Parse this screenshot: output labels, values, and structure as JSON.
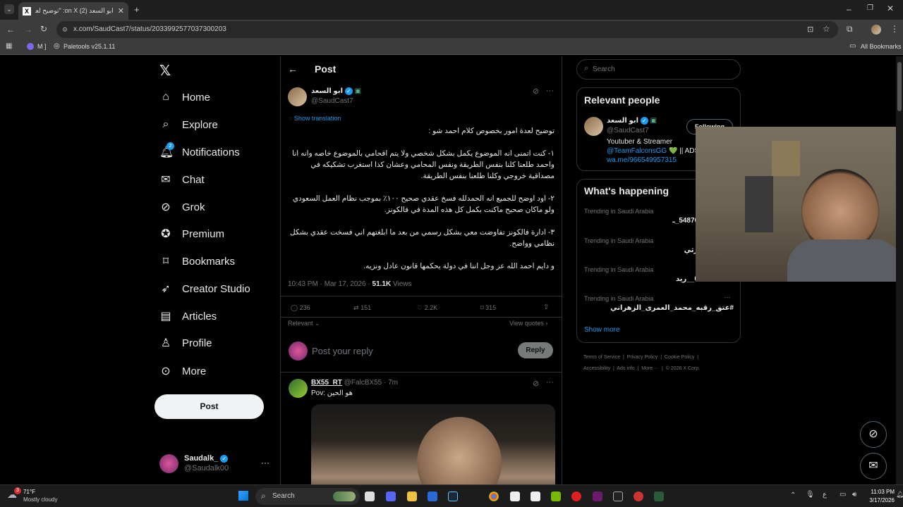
{
  "browser": {
    "tab_title": "ابو السعد (2) on X: \"توضيح لعدة",
    "url": "x.com/SaudCast7/status/2033992577037300203",
    "bookmarks": [
      "M ]",
      "Paletools v25.1.11"
    ],
    "all_bookmarks": "All Bookmarks"
  },
  "nav": {
    "items": [
      {
        "label": "Home",
        "icon": "home-icon"
      },
      {
        "label": "Explore",
        "icon": "search-icon"
      },
      {
        "label": "Notifications",
        "icon": "bell-icon",
        "badge": "2"
      },
      {
        "label": "Chat",
        "icon": "mail-icon"
      },
      {
        "label": "Grok",
        "icon": "grok-icon"
      },
      {
        "label": "Premium",
        "icon": "premium-icon"
      },
      {
        "label": "Bookmarks",
        "icon": "bookmark-icon"
      },
      {
        "label": "Creator Studio",
        "icon": "rocket-icon"
      },
      {
        "label": "Articles",
        "icon": "article-icon"
      },
      {
        "label": "Profile",
        "icon": "person-icon"
      },
      {
        "label": "More",
        "icon": "more-circle-icon"
      }
    ],
    "post_button": "Post",
    "account": {
      "name": "Saudalk_",
      "handle": "@Saudalk00"
    }
  },
  "post": {
    "header": "Post",
    "author_name": "ابو السعد",
    "author_handle": "@SaudCast7",
    "show_translation": "Show translation",
    "paragraphs": [
      "توضيح لعدة امور بخصوص كلام احمد شو :",
      "١- كنت اتمنى انه الموضوع يكمل بشكل شخصي ولا يتم اقحامي بالموضوع خاصه وانه انا واحمد طلعنا كلنا بنفس الطريقة ونفس المحامي وعشان كذا استغرب تشكيكه في مصداقية خروجي وكلنا طلعنا بنفس الطريقة.",
      "٢- اود اوضح للجميع انه الحمدلله فسخ عقدي صحيح ١٠٠٪ بموجب نظام العمل السعودي ولو ماكان صحيح ماكنت بكمل كل هذه المدة في فالكونز.",
      "٣- ادارة فالكونز تفاوضت معي بشكل رسمي من بعد ما ابلغتهم اني فسخت عقدي بشكل نظامي وواضح.",
      "و دايم احمد الله عز وجل اننا في دولة يحكمها قانون عادل ونزيه."
    ],
    "timestamp": "10:43 PM · Mar 17, 2026 · ",
    "views_count": "51.1K",
    "views_label": " Views",
    "stats": {
      "replies": "236",
      "reposts": "151",
      "likes": "2.2K",
      "bookmarks": "315"
    },
    "relevant_label": "Relevant",
    "view_quotes": "View quotes",
    "reply_placeholder": "Post your reply",
    "reply_button": "Reply"
  },
  "reply": {
    "name": "BX55_RT",
    "handle": "@FalcBX55 · 7m",
    "text": "Pov: هو الحين"
  },
  "sidebar": {
    "search_placeholder": "Search",
    "relevant_title": "Relevant people",
    "person": {
      "name": "ابو السعد",
      "handle": "@SaudCast7",
      "follow_label": "Following",
      "bio_line1": "Youtuber & Streamer",
      "bio_link": "@TeamFalconsGG",
      "bio_rest": " 💚 || ADS",
      "bio_line3": "wa.me/966549957315"
    },
    "happening_title": "What's happening",
    "trends": [
      {
        "context": "Trending in Saudi Arabia",
        "topic": "0ڛ4ڛ5487613_ـ"
      },
      {
        "context": "Trending in Saudi Arabia",
        "topic": "9ـ بدر_الحارثي"
      },
      {
        "context": "Trending in Saudi Arabia",
        "topic": "0532221348__ريد"
      },
      {
        "context": "Trending in Saudi Arabia",
        "topic": "#عتق_رقبه_محمد_العمرى_الزهراني"
      }
    ],
    "show_more": "Show more",
    "footer": [
      "Terms of Service",
      "Privacy Policy",
      "Cookie Policy",
      "Accessibility",
      "Ads info",
      "More ···",
      "© 2026 X Corp."
    ]
  },
  "taskbar": {
    "weather_temp": "71°F",
    "weather_desc": "Mostly cloudy",
    "search": "Search",
    "time": "11:03 PM",
    "date": "3/17/2026",
    "weather_badge": "3"
  }
}
